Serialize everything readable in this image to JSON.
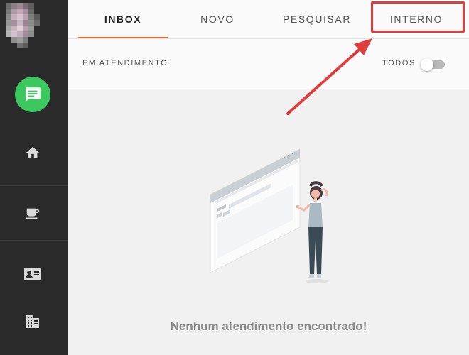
{
  "sidebar": {
    "items": [
      {
        "name": "chat",
        "icon": "chat-icon",
        "active": true
      },
      {
        "name": "home",
        "icon": "home-icon"
      },
      {
        "name": "coffee",
        "icon": "coffee-icon"
      },
      {
        "name": "contact",
        "icon": "contact-card-icon"
      },
      {
        "name": "building",
        "icon": "building-icon"
      }
    ]
  },
  "tabs": [
    {
      "label": "INBOX",
      "active": true
    },
    {
      "label": "NOVO"
    },
    {
      "label": "PESQUISAR"
    },
    {
      "label": "INTERNO",
      "highlighted": true
    }
  ],
  "subheader": {
    "title": "EM ATENDIMENTO",
    "toggle_label": "TODOS",
    "toggle_on": false
  },
  "content": {
    "empty_message": "Nenhum atendimento encontrado!"
  },
  "colors": {
    "sidebar_bg": "#2a2a2a",
    "chat_active": "#3cc85f",
    "tab_underline": "#e56a35",
    "annotation_red": "#e03c3c"
  }
}
